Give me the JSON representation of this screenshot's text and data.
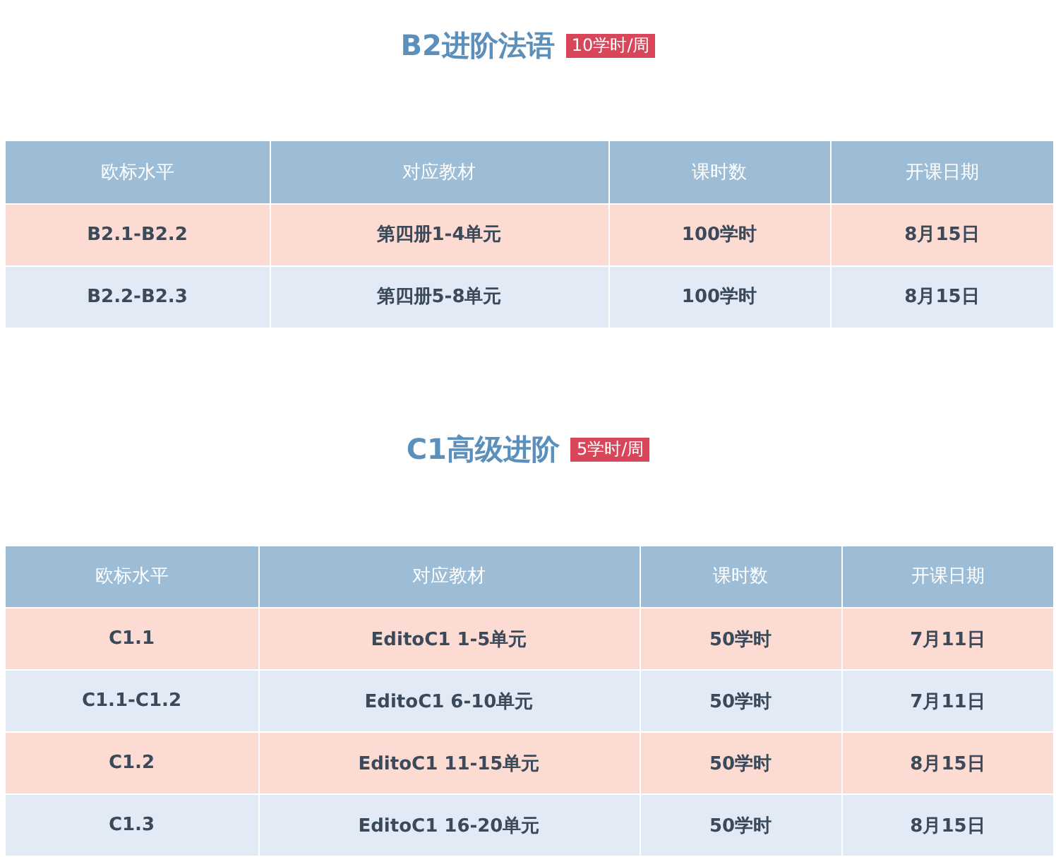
{
  "sections": [
    {
      "title": "B2进阶法语",
      "badge": "10学时/周",
      "table": {
        "columns": [
          "欧标水平",
          "对应教材",
          "课时数",
          "开课日期"
        ],
        "rows": [
          [
            "B2.1-B2.2",
            "第四册1-4单元",
            "100学时",
            "8月15日"
          ],
          [
            "B2.2-B2.3",
            "第四册5-8单元",
            "100学时",
            "8月15日"
          ]
        ]
      }
    },
    {
      "title": "C1高级进阶",
      "badge": "5学时/周",
      "table": {
        "columns": [
          "欧标水平",
          "对应教材",
          "课时数",
          "开课日期"
        ],
        "rows": [
          [
            "C1.1",
            "EditoC1 1-5单元",
            "50学时",
            "7月11日"
          ],
          [
            "C1.1-C1.2",
            "EditoC1 6-10单元",
            "50学时",
            "7月11日"
          ],
          [
            "C1.2",
            "EditoC1 11-15单元",
            "50学时",
            "8月15日"
          ],
          [
            "C1.3",
            "EditoC1 16-20单元",
            "50学时",
            "8月15日"
          ]
        ]
      }
    }
  ]
}
